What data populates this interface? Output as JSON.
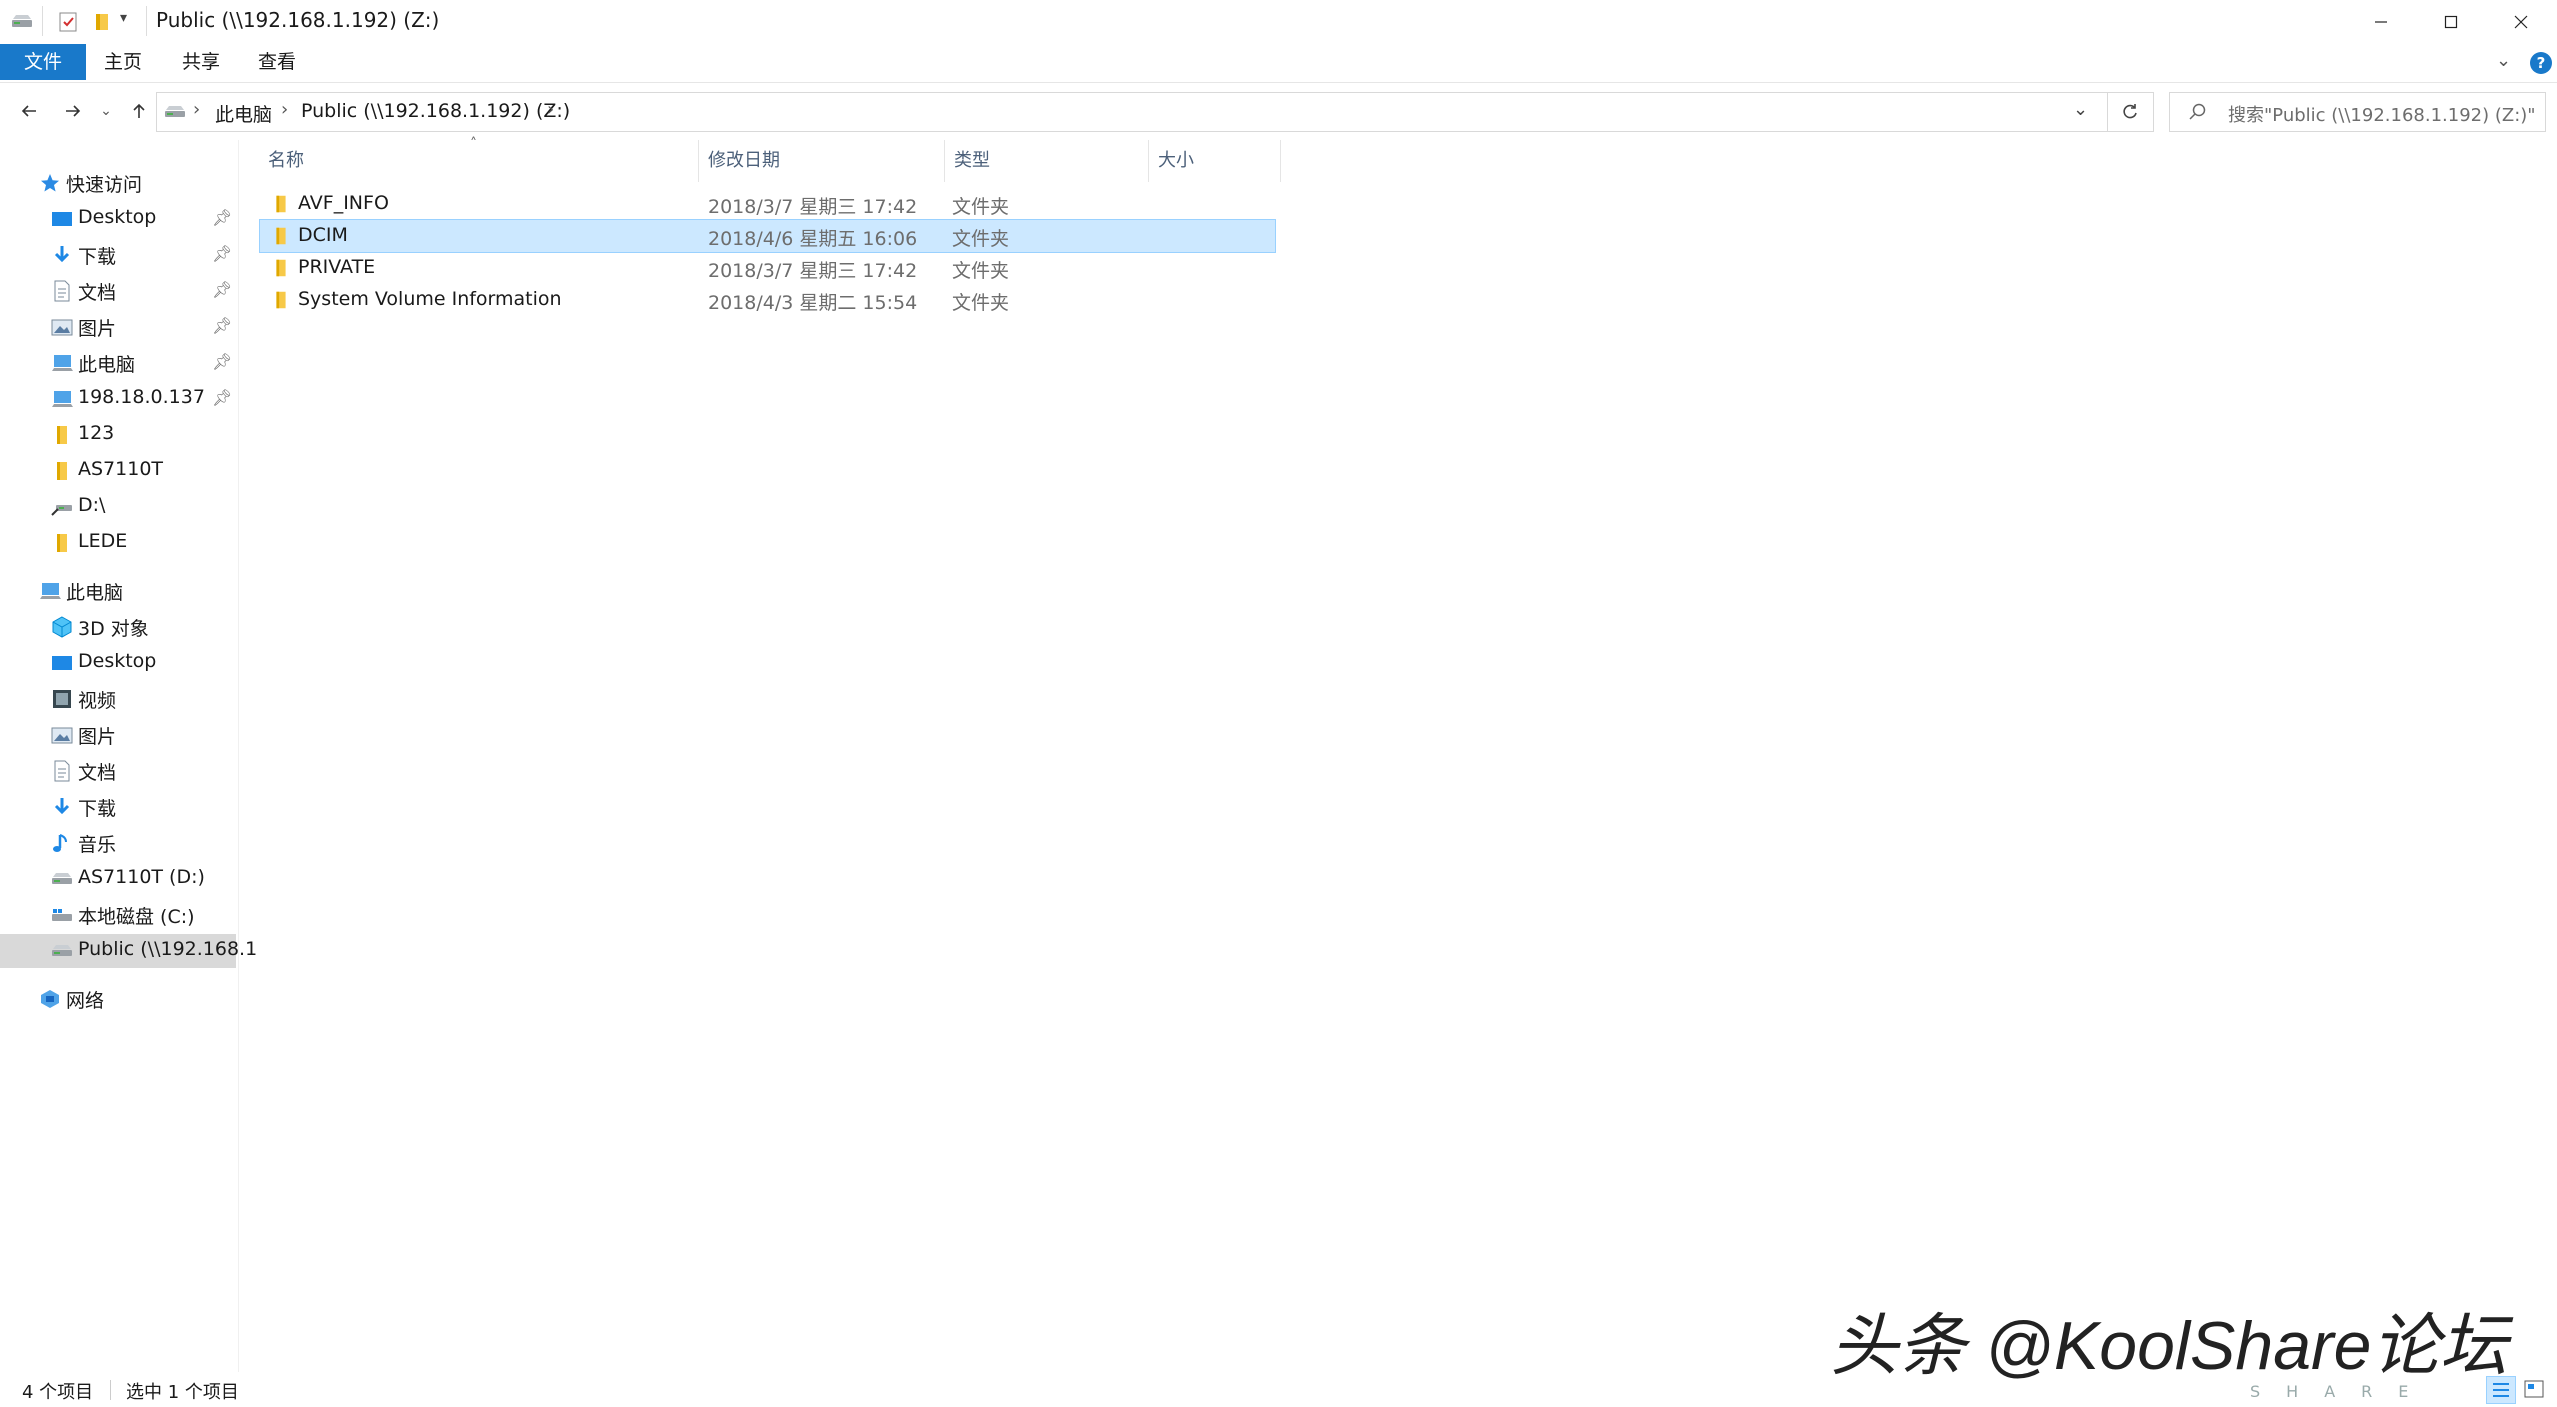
{
  "window": {
    "title": "Public (\\\\192.168.1.192) (Z:)"
  },
  "ribbon": {
    "tabs": [
      "文件",
      "主页",
      "共享",
      "查看"
    ]
  },
  "navbar": {
    "breadcrumb": [
      "此电脑",
      "Public (\\\\192.168.1.192) (Z:)"
    ],
    "search_placeholder": "搜索\"Public (\\\\192.168.1.192) (Z:)\""
  },
  "sidebar": {
    "quick_access": {
      "label": "快速访问",
      "items": [
        {
          "label": "Desktop",
          "icon": "desktop-icon",
          "pinned": true
        },
        {
          "label": "下载",
          "icon": "download-icon",
          "pinned": true
        },
        {
          "label": "文档",
          "icon": "document-icon",
          "pinned": true
        },
        {
          "label": "图片",
          "icon": "picture-icon",
          "pinned": true
        },
        {
          "label": "此电脑",
          "icon": "computer-icon",
          "pinned": true
        },
        {
          "label": "198.18.0.137",
          "icon": "network-computer-icon",
          "pinned": true
        },
        {
          "label": "123",
          "icon": "folder-icon",
          "pinned": false
        },
        {
          "label": "AS7110T",
          "icon": "folder-icon",
          "pinned": false
        },
        {
          "label": "D:\\",
          "icon": "network-drive-icon",
          "pinned": false
        },
        {
          "label": "LEDE",
          "icon": "folder-icon",
          "pinned": false
        }
      ]
    },
    "this_pc": {
      "label": "此电脑",
      "items": [
        {
          "label": "3D 对象",
          "icon": "3d-objects-icon"
        },
        {
          "label": "Desktop",
          "icon": "desktop-icon"
        },
        {
          "label": "视频",
          "icon": "video-icon"
        },
        {
          "label": "图片",
          "icon": "picture-icon"
        },
        {
          "label": "文档",
          "icon": "document-icon"
        },
        {
          "label": "下载",
          "icon": "download-icon"
        },
        {
          "label": "音乐",
          "icon": "music-icon"
        },
        {
          "label": "AS7110T (D:)",
          "icon": "network-drive-icon"
        },
        {
          "label": "本地磁盘 (C:)",
          "icon": "local-disk-icon"
        },
        {
          "label": "Public (\\\\192.168.1",
          "icon": "network-drive-icon",
          "selected": true
        }
      ]
    },
    "network": {
      "label": "网络"
    }
  },
  "filelist": {
    "columns": [
      "名称",
      "修改日期",
      "类型",
      "大小"
    ],
    "rows": [
      {
        "name": "AVF_INFO",
        "date": "2018/3/7 星期三 17:42",
        "type": "文件夹",
        "size": "",
        "selected": false
      },
      {
        "name": "DCIM",
        "date": "2018/4/6 星期五 16:06",
        "type": "文件夹",
        "size": "",
        "selected": true
      },
      {
        "name": "PRIVATE",
        "date": "2018/3/7 星期三 17:42",
        "type": "文件夹",
        "size": "",
        "selected": false
      },
      {
        "name": "System Volume Information",
        "date": "2018/4/3 星期二 15:54",
        "type": "文件夹",
        "size": "",
        "selected": false
      }
    ]
  },
  "statusbar": {
    "item_count": "4 个项目",
    "selected_count": "选中 1 个项目"
  },
  "watermark": {
    "text": "头条 @KoolShare论坛",
    "sub": "SHARE"
  },
  "colors": {
    "accent": "#1979ca",
    "selection": "#cce8ff",
    "folder": "#f7c948"
  }
}
